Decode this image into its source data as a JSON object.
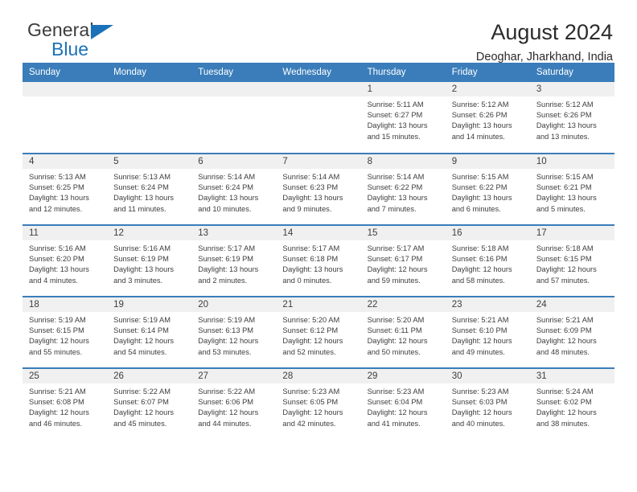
{
  "logo": {
    "word_top": "General",
    "word_bottom": "Blue",
    "triangle_icon": "blue-triangle-icon",
    "accent_color": "#1b72b8"
  },
  "header": {
    "title": "August 2024",
    "subtitle": "Deoghar, Jharkhand, India"
  },
  "theme": {
    "header_blue": "#3a7dba",
    "daynum_strip": "#f0f0f0",
    "text": "#3d3d3d"
  },
  "labels": {
    "sunrise_prefix": "Sunrise:",
    "sunset_prefix": "Sunset:",
    "daylight_prefix": "Daylight:"
  },
  "weekday_headers": [
    "Sunday",
    "Monday",
    "Tuesday",
    "Wednesday",
    "Thursday",
    "Friday",
    "Saturday"
  ],
  "weeks": [
    [
      {
        "day": "",
        "empty": true
      },
      {
        "day": "",
        "empty": true
      },
      {
        "day": "",
        "empty": true
      },
      {
        "day": "",
        "empty": true
      },
      {
        "day": "1",
        "sunrise": "Sunrise: 5:11 AM",
        "sunset": "Sunset: 6:27 PM",
        "daylight_line1": "Daylight: 13 hours",
        "daylight_line2": "and 15 minutes."
      },
      {
        "day": "2",
        "sunrise": "Sunrise: 5:12 AM",
        "sunset": "Sunset: 6:26 PM",
        "daylight_line1": "Daylight: 13 hours",
        "daylight_line2": "and 14 minutes."
      },
      {
        "day": "3",
        "sunrise": "Sunrise: 5:12 AM",
        "sunset": "Sunset: 6:26 PM",
        "daylight_line1": "Daylight: 13 hours",
        "daylight_line2": "and 13 minutes."
      }
    ],
    [
      {
        "day": "4",
        "sunrise": "Sunrise: 5:13 AM",
        "sunset": "Sunset: 6:25 PM",
        "daylight_line1": "Daylight: 13 hours",
        "daylight_line2": "and 12 minutes."
      },
      {
        "day": "5",
        "sunrise": "Sunrise: 5:13 AM",
        "sunset": "Sunset: 6:24 PM",
        "daylight_line1": "Daylight: 13 hours",
        "daylight_line2": "and 11 minutes."
      },
      {
        "day": "6",
        "sunrise": "Sunrise: 5:14 AM",
        "sunset": "Sunset: 6:24 PM",
        "daylight_line1": "Daylight: 13 hours",
        "daylight_line2": "and 10 minutes."
      },
      {
        "day": "7",
        "sunrise": "Sunrise: 5:14 AM",
        "sunset": "Sunset: 6:23 PM",
        "daylight_line1": "Daylight: 13 hours",
        "daylight_line2": "and 9 minutes."
      },
      {
        "day": "8",
        "sunrise": "Sunrise: 5:14 AM",
        "sunset": "Sunset: 6:22 PM",
        "daylight_line1": "Daylight: 13 hours",
        "daylight_line2": "and 7 minutes."
      },
      {
        "day": "9",
        "sunrise": "Sunrise: 5:15 AM",
        "sunset": "Sunset: 6:22 PM",
        "daylight_line1": "Daylight: 13 hours",
        "daylight_line2": "and 6 minutes."
      },
      {
        "day": "10",
        "sunrise": "Sunrise: 5:15 AM",
        "sunset": "Sunset: 6:21 PM",
        "daylight_line1": "Daylight: 13 hours",
        "daylight_line2": "and 5 minutes."
      }
    ],
    [
      {
        "day": "11",
        "sunrise": "Sunrise: 5:16 AM",
        "sunset": "Sunset: 6:20 PM",
        "daylight_line1": "Daylight: 13 hours",
        "daylight_line2": "and 4 minutes."
      },
      {
        "day": "12",
        "sunrise": "Sunrise: 5:16 AM",
        "sunset": "Sunset: 6:19 PM",
        "daylight_line1": "Daylight: 13 hours",
        "daylight_line2": "and 3 minutes."
      },
      {
        "day": "13",
        "sunrise": "Sunrise: 5:17 AM",
        "sunset": "Sunset: 6:19 PM",
        "daylight_line1": "Daylight: 13 hours",
        "daylight_line2": "and 2 minutes."
      },
      {
        "day": "14",
        "sunrise": "Sunrise: 5:17 AM",
        "sunset": "Sunset: 6:18 PM",
        "daylight_line1": "Daylight: 13 hours",
        "daylight_line2": "and 0 minutes."
      },
      {
        "day": "15",
        "sunrise": "Sunrise: 5:17 AM",
        "sunset": "Sunset: 6:17 PM",
        "daylight_line1": "Daylight: 12 hours",
        "daylight_line2": "and 59 minutes."
      },
      {
        "day": "16",
        "sunrise": "Sunrise: 5:18 AM",
        "sunset": "Sunset: 6:16 PM",
        "daylight_line1": "Daylight: 12 hours",
        "daylight_line2": "and 58 minutes."
      },
      {
        "day": "17",
        "sunrise": "Sunrise: 5:18 AM",
        "sunset": "Sunset: 6:15 PM",
        "daylight_line1": "Daylight: 12 hours",
        "daylight_line2": "and 57 minutes."
      }
    ],
    [
      {
        "day": "18",
        "sunrise": "Sunrise: 5:19 AM",
        "sunset": "Sunset: 6:15 PM",
        "daylight_line1": "Daylight: 12 hours",
        "daylight_line2": "and 55 minutes."
      },
      {
        "day": "19",
        "sunrise": "Sunrise: 5:19 AM",
        "sunset": "Sunset: 6:14 PM",
        "daylight_line1": "Daylight: 12 hours",
        "daylight_line2": "and 54 minutes."
      },
      {
        "day": "20",
        "sunrise": "Sunrise: 5:19 AM",
        "sunset": "Sunset: 6:13 PM",
        "daylight_line1": "Daylight: 12 hours",
        "daylight_line2": "and 53 minutes."
      },
      {
        "day": "21",
        "sunrise": "Sunrise: 5:20 AM",
        "sunset": "Sunset: 6:12 PM",
        "daylight_line1": "Daylight: 12 hours",
        "daylight_line2": "and 52 minutes."
      },
      {
        "day": "22",
        "sunrise": "Sunrise: 5:20 AM",
        "sunset": "Sunset: 6:11 PM",
        "daylight_line1": "Daylight: 12 hours",
        "daylight_line2": "and 50 minutes."
      },
      {
        "day": "23",
        "sunrise": "Sunrise: 5:21 AM",
        "sunset": "Sunset: 6:10 PM",
        "daylight_line1": "Daylight: 12 hours",
        "daylight_line2": "and 49 minutes."
      },
      {
        "day": "24",
        "sunrise": "Sunrise: 5:21 AM",
        "sunset": "Sunset: 6:09 PM",
        "daylight_line1": "Daylight: 12 hours",
        "daylight_line2": "and 48 minutes."
      }
    ],
    [
      {
        "day": "25",
        "sunrise": "Sunrise: 5:21 AM",
        "sunset": "Sunset: 6:08 PM",
        "daylight_line1": "Daylight: 12 hours",
        "daylight_line2": "and 46 minutes."
      },
      {
        "day": "26",
        "sunrise": "Sunrise: 5:22 AM",
        "sunset": "Sunset: 6:07 PM",
        "daylight_line1": "Daylight: 12 hours",
        "daylight_line2": "and 45 minutes."
      },
      {
        "day": "27",
        "sunrise": "Sunrise: 5:22 AM",
        "sunset": "Sunset: 6:06 PM",
        "daylight_line1": "Daylight: 12 hours",
        "daylight_line2": "and 44 minutes."
      },
      {
        "day": "28",
        "sunrise": "Sunrise: 5:23 AM",
        "sunset": "Sunset: 6:05 PM",
        "daylight_line1": "Daylight: 12 hours",
        "daylight_line2": "and 42 minutes."
      },
      {
        "day": "29",
        "sunrise": "Sunrise: 5:23 AM",
        "sunset": "Sunset: 6:04 PM",
        "daylight_line1": "Daylight: 12 hours",
        "daylight_line2": "and 41 minutes."
      },
      {
        "day": "30",
        "sunrise": "Sunrise: 5:23 AM",
        "sunset": "Sunset: 6:03 PM",
        "daylight_line1": "Daylight: 12 hours",
        "daylight_line2": "and 40 minutes."
      },
      {
        "day": "31",
        "sunrise": "Sunrise: 5:24 AM",
        "sunset": "Sunset: 6:02 PM",
        "daylight_line1": "Daylight: 12 hours",
        "daylight_line2": "and 38 minutes."
      }
    ]
  ]
}
